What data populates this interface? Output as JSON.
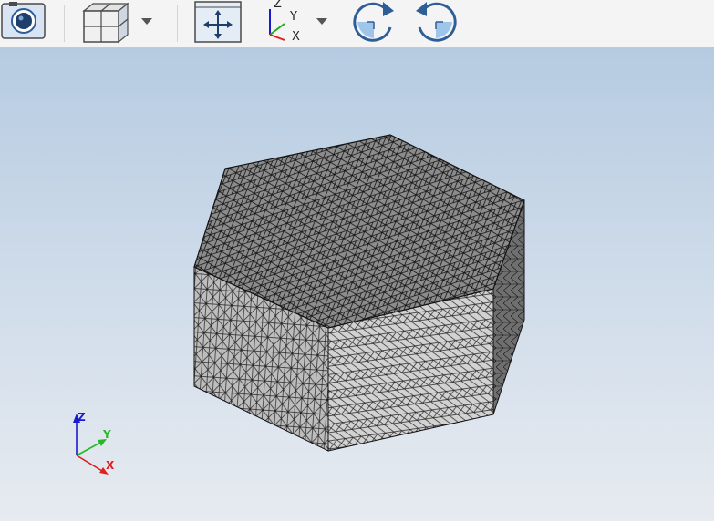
{
  "toolbar": {
    "axis_labels": {
      "z": "Z",
      "y": "Y",
      "x": "X"
    }
  },
  "triad": {
    "z": "Z",
    "y": "Y",
    "x": "X"
  },
  "colors": {
    "toolbar_bg": "#f4f4f4",
    "icon_blue": "#2e5e96",
    "viewport_top": "#b6cbe1",
    "viewport_bottom": "#e7ebf0",
    "mesh_top": "#8c8c8c",
    "mesh_left": "#bdbdbd",
    "mesh_right": "#d2d2d2",
    "mesh_far": "#6f6f6f",
    "axis_x": "#e02020",
    "axis_y": "#22bb22",
    "axis_z": "#1a1ad0"
  },
  "icons": [
    "camera-icon",
    "grid-box-icon",
    "dropdown-arrow-icon",
    "fit-view-icon",
    "axis-orientation-icon",
    "dropdown-arrow-icon",
    "rotate-cw-icon",
    "rotate-ccw-icon"
  ]
}
